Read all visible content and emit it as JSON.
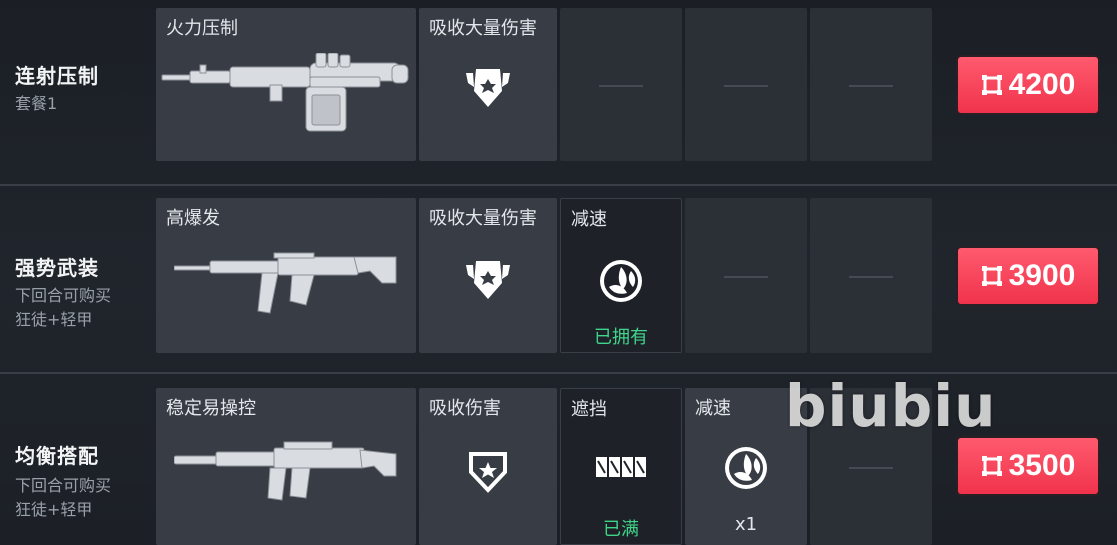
{
  "packages": [
    {
      "name": "连射压制",
      "sub1": "套餐1",
      "sub2": "",
      "weapon_title": "火力压制",
      "armor_title": "吸收大量伤害",
      "price": "4200"
    },
    {
      "name": "强势武装",
      "sub1": "下回合可购买",
      "sub2": "狂徒+轻甲",
      "weapon_title": "高爆发",
      "armor_title": "吸收大量伤害",
      "ability_title": "减速",
      "ability_status": "已拥有",
      "price": "3900"
    },
    {
      "name": "均衡搭配",
      "sub1": "下回合可购买",
      "sub2": "狂徒+轻甲",
      "weapon_title": "稳定易操控",
      "armor_title": "吸收伤害",
      "ability1_title": "遮挡",
      "ability1_status": "已满",
      "ability2_title": "减速",
      "ability2_count": "x1",
      "price": "3500"
    }
  ],
  "watermark": "biubiu",
  "colors": {
    "price_button": "#f0334c",
    "owned_status": "#3fd58a",
    "card": "#383c44"
  },
  "icons": [
    "credits-icon",
    "heavy-shield-icon",
    "light-shield-icon",
    "slow-orb-icon",
    "barrier-icon"
  ]
}
